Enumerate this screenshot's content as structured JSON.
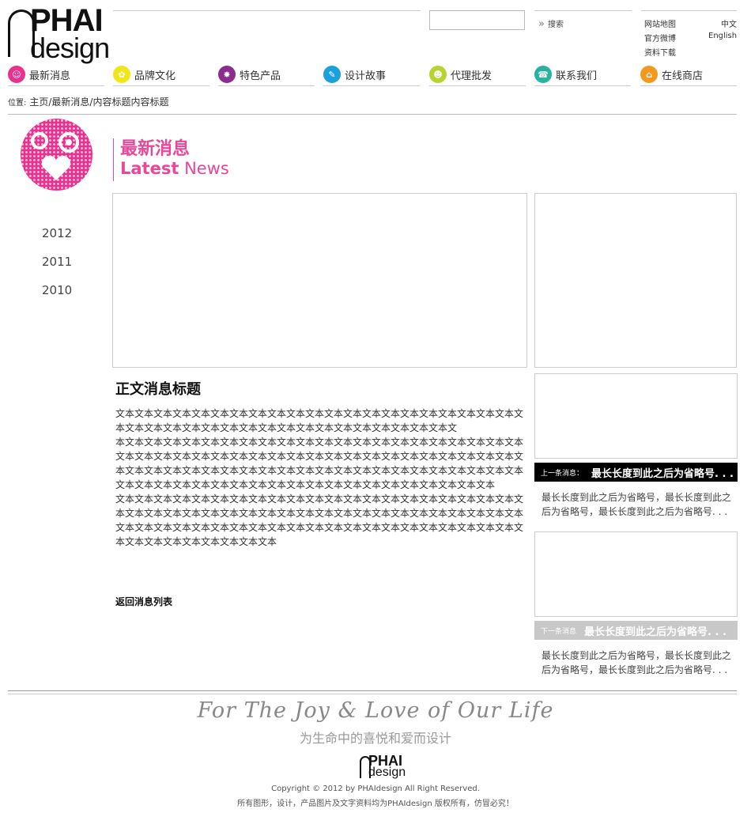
{
  "logo": {
    "top": "PHAI",
    "bottom": "design"
  },
  "header": {
    "search_label": "搜索",
    "links": [
      "网站地图",
      "中文",
      "官方微博",
      "English",
      "资料下载"
    ]
  },
  "nav": [
    {
      "label": "最新消息",
      "color": "#e9318f",
      "icon": "smile-icon"
    },
    {
      "label": "品牌文化",
      "color": "#f2e51a",
      "icon": "flower-icon"
    },
    {
      "label": "特色产品",
      "color": "#8a2d8c",
      "icon": "star-icon"
    },
    {
      "label": "设计故事",
      "color": "#1aa1dc",
      "icon": "story-icon"
    },
    {
      "label": "代理批发",
      "color": "#b7d330",
      "icon": "agent-icon"
    },
    {
      "label": "联系我们",
      "color": "#26b3a1",
      "icon": "contact-icon"
    },
    {
      "label": "在线商店",
      "color": "#f39a1e",
      "icon": "shop-icon"
    }
  ],
  "breadcrumb": {
    "prefix": "位置:",
    "path": "主页/最新消息/内容标题内容标题"
  },
  "sidebar": {
    "years": [
      "2012",
      "2011",
      "2010"
    ]
  },
  "section": {
    "title_cn": "最新消息",
    "title_en_bold": "Latest",
    "title_en": "News"
  },
  "article": {
    "title": "正文消息标题",
    "paragraphs": [
      "文本文本文本文本文本文本文本文本文本文本文本文本文本文本文本文本文本文本文本文本文本文本文本文本文本文本文本文本文本文本文本文本文本文本文本文本文本文本文本文",
      "本文本文本文本文本文本文本文本文本文本文本文本文本文本文本文本文本文本文本文本文本文本文本文本文本文本文本文本文本文本文本文本文本文本文本文本文本文本文本文本文本文本文本文本文本文本文本文本文本文本文本文本文本文本文本文本文本文本文本文本文本文本文本文本文本文本文本文本文本文本文本文本文本文本文本文本文本文本文本文本文本文本文本文本文本",
      "文本文本文本文本文本文本文本文本文本文本文本文本文本文本文本文本文本文本文本文本文本文本文本文本文本文本文本文本文本文本文本文本文本文本文本文本文本文本文本文本文本文本文本文本文本文本文本文本文本文本文本文本文本文本文本文本文本文本文本文本文本文本文本文本文本文本文本文本文本文本文本文本文本"
    ],
    "back_label": "返回消息列表"
  },
  "prev": {
    "label": "上一条消息：",
    "title": "最长长度到此之后为省略号. . .",
    "excerpt": "最长长度到此之后为省略号，最长长度到此之后为省略号，最长长度到此之后为省略号. . ."
  },
  "next": {
    "label": "下一条消息",
    "title": "最长长度到此之后为省略号. . .",
    "excerpt": "最长长度到此之后为省略号，最长长度到此之后为省略号，最长长度到此之后为省略号. . ."
  },
  "footer": {
    "slogan": "For The Joy & Love of Our Life",
    "slogan_cn": "为生命中的喜悦和爱而设计",
    "copyright": "Copyright © 2012 by PHAIdesign All Right Reserved.",
    "notice": "所有图形，设计，产品图片及文字资料均为PHAIdesign  版权所有，仿冒必究！"
  }
}
